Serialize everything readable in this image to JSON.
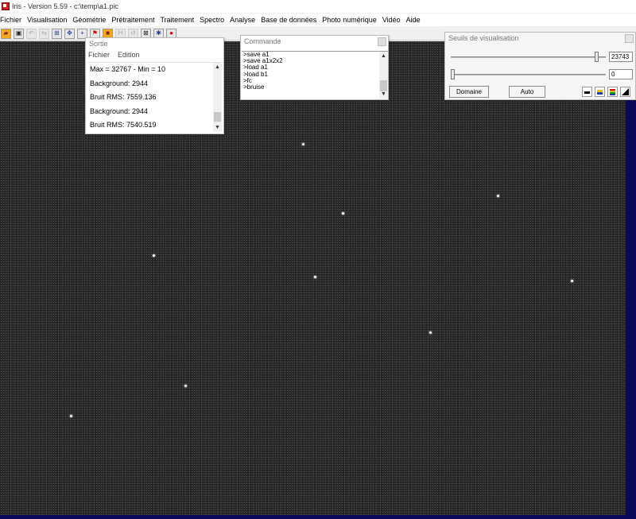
{
  "window": {
    "title": "Iris - Version 5.59 - c:\\temp\\a1.pic"
  },
  "menu": [
    "Fichier",
    "Visualisation",
    "Géométrie",
    "Prétraitement",
    "Traitement",
    "Spectro",
    "Analyse",
    "Base de données",
    "Photo numérique",
    "Vidéo",
    "Aide"
  ],
  "toolbar": {
    "icons": [
      "open-icon",
      "save-icon",
      "undo-icon",
      "redo-icon",
      "zoom-in-icon",
      "move-icon",
      "crosshair-icon",
      "red-flag-icon",
      "palette-icon",
      "histogram-icon",
      "undo-arrow-icon",
      "grid-icon",
      "blue-star-icon",
      "red-dot-icon"
    ]
  },
  "sortie": {
    "title": "Sortie",
    "menu": [
      "Fichier",
      "Edition"
    ],
    "lines": [
      "Max = 32767 - Min = 10",
      "Background: 2944",
      "Bruit RMS: 7559.136",
      "Background: 2944",
      "Bruit RMS: 7540.519"
    ]
  },
  "commande": {
    "title": "Commande",
    "lines": [
      ">save a1",
      ">save a1x2x2",
      ">load a1",
      ">load b1",
      ">fc",
      ">bruise"
    ]
  },
  "seuils": {
    "title": "Seuils de visualisation",
    "high_value": "23743",
    "low_value": "0",
    "high_level": 0.95,
    "low_level": 0.0,
    "buttons": {
      "domaine": "Domaine",
      "auto": "Auto"
    },
    "palette_icons": [
      "palette-bw-icon",
      "palette-yellow-icon",
      "palette-rainbow-icon",
      "palette-gradient-icon"
    ]
  },
  "colors": {
    "canvas_background": "#2a2a2a",
    "frame_blue": "#0a0a5a"
  }
}
